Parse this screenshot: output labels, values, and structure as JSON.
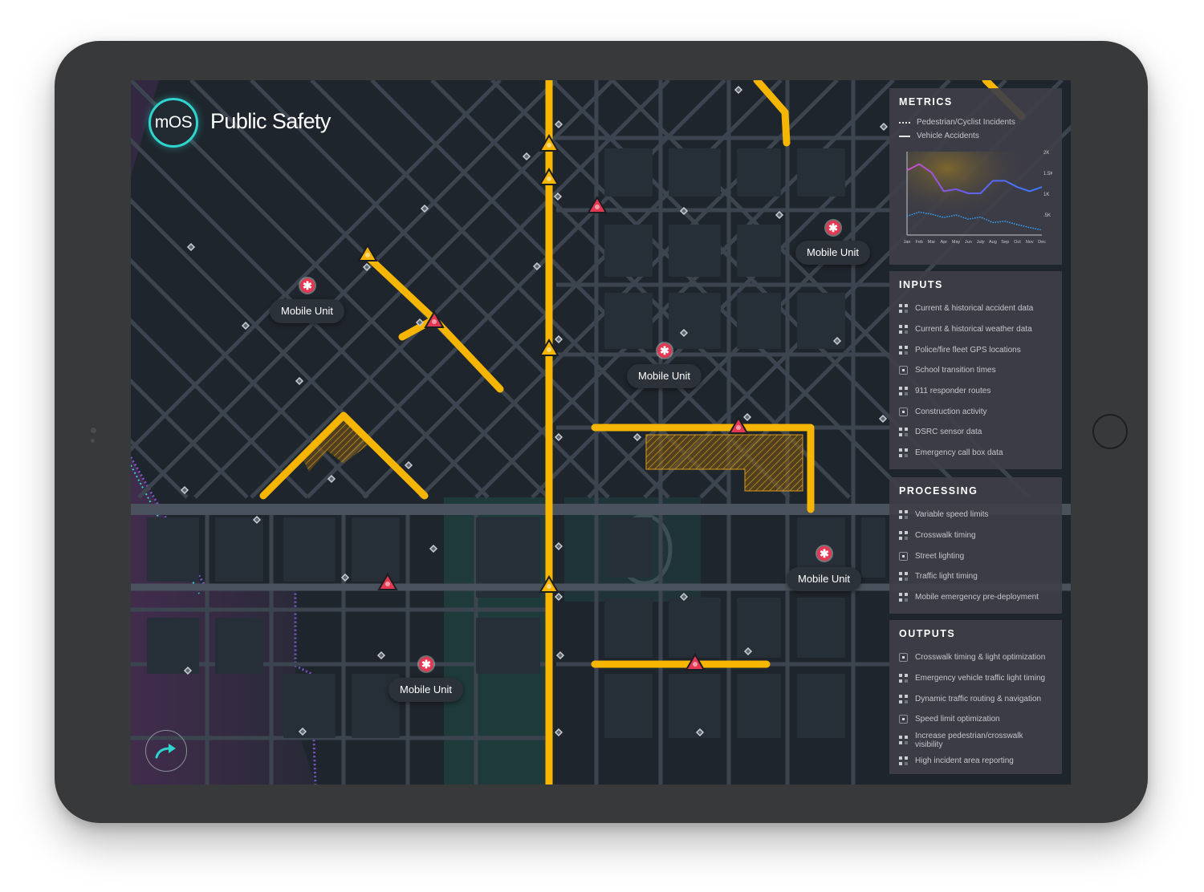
{
  "app": {
    "logo_text": "mOS",
    "title": "Public Safety"
  },
  "map": {
    "mobile_units": [
      {
        "label": "Mobile Unit"
      },
      {
        "label": "Mobile Unit"
      },
      {
        "label": "Mobile Unit"
      },
      {
        "label": "Mobile Unit"
      },
      {
        "label": "Mobile Unit"
      }
    ],
    "colors": {
      "route": "#f5b500",
      "alert": "#e33752",
      "accent": "#2fd4cf",
      "district_border": "#7b54c7"
    }
  },
  "metrics": {
    "heading": "METRICS",
    "legend": [
      {
        "label": "Pedestrian/Cyclist Incidents",
        "style": "dotted"
      },
      {
        "label": "Vehicle Accidents",
        "style": "solid"
      }
    ],
    "chart_data": {
      "type": "line",
      "x": [
        "Jan",
        "Feb",
        "Mar",
        "Apr",
        "May",
        "Jun",
        "July",
        "Aug",
        "Sep",
        "Oct",
        "Nov",
        "Dec"
      ],
      "yticks": [
        "2K",
        "1.5K",
        "1K",
        ".5K"
      ],
      "ylim": [
        0,
        2000
      ],
      "series": [
        {
          "name": "Vehicle Accidents",
          "values": [
            1550,
            1700,
            1500,
            1050,
            1100,
            1000,
            1000,
            1300,
            1300,
            1150,
            1050,
            1150
          ]
        },
        {
          "name": "Pedestrian/Cyclist Incidents",
          "values": [
            450,
            550,
            500,
            420,
            480,
            380,
            430,
            300,
            330,
            250,
            180,
            120
          ]
        }
      ]
    }
  },
  "inputs": {
    "heading": "INPUTS",
    "items": [
      {
        "label": "Current & historical accident data",
        "icon": "grid-icon"
      },
      {
        "label": "Current & historical weather data",
        "icon": "grid-icon"
      },
      {
        "label": "Police/fire fleet GPS locations",
        "icon": "grid-icon"
      },
      {
        "label": "School transition times",
        "icon": "box-icon"
      },
      {
        "label": "911 responder routes",
        "icon": "grid-icon"
      },
      {
        "label": "Construction activity",
        "icon": "box-icon"
      },
      {
        "label": "DSRC sensor data",
        "icon": "grid-icon"
      },
      {
        "label": "Emergency call box data",
        "icon": "grid-icon"
      }
    ]
  },
  "processing": {
    "heading": "PROCESSING",
    "items": [
      {
        "label": "Variable speed limits",
        "icon": "grid-icon"
      },
      {
        "label": "Crosswalk timing",
        "icon": "grid-icon"
      },
      {
        "label": "Street lighting",
        "icon": "box-icon"
      },
      {
        "label": "Traffic light timing",
        "icon": "grid-icon"
      },
      {
        "label": "Mobile emergency pre-deployment",
        "icon": "grid-icon"
      }
    ]
  },
  "outputs": {
    "heading": "OUTPUTS",
    "items": [
      {
        "label": "Crosswalk timing & light optimization",
        "icon": "box-icon"
      },
      {
        "label": "Emergency vehicle traffic light timing",
        "icon": "grid-icon"
      },
      {
        "label": "Dynamic traffic routing & navigation",
        "icon": "grid-icon"
      },
      {
        "label": "Speed limit optimization",
        "icon": "box-icon"
      },
      {
        "label": "Increase pedestrian/crosswalk visibility",
        "icon": "grid-icon"
      },
      {
        "label": "High incident area reporting",
        "icon": "grid-icon"
      }
    ]
  }
}
